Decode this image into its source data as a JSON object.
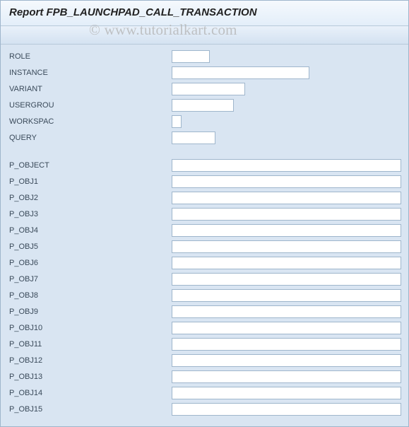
{
  "title": "Report FPB_LAUNCHPAD_CALL_TRANSACTION",
  "watermark": "© www.tutorialkart.com",
  "section1": [
    {
      "label": "ROLE",
      "wclass": "input-role",
      "value": ""
    },
    {
      "label": "INSTANCE",
      "wclass": "input-instance",
      "value": ""
    },
    {
      "label": "VARIANT",
      "wclass": "input-variant",
      "value": ""
    },
    {
      "label": "USERGROU",
      "wclass": "input-usergrou",
      "value": ""
    },
    {
      "label": "WORKSPAC",
      "wclass": "input-workspac",
      "value": ""
    },
    {
      "label": "QUERY",
      "wclass": "input-query",
      "value": ""
    }
  ],
  "section2": [
    {
      "label": "P_OBJECT",
      "value": ""
    },
    {
      "label": "P_OBJ1",
      "value": ""
    },
    {
      "label": "P_OBJ2",
      "value": ""
    },
    {
      "label": "P_OBJ3",
      "value": ""
    },
    {
      "label": "P_OBJ4",
      "value": ""
    },
    {
      "label": "P_OBJ5",
      "value": ""
    },
    {
      "label": "P_OBJ6",
      "value": ""
    },
    {
      "label": "P_OBJ7",
      "value": ""
    },
    {
      "label": "P_OBJ8",
      "value": ""
    },
    {
      "label": "P_OBJ9",
      "value": ""
    },
    {
      "label": "P_OBJ10",
      "value": ""
    },
    {
      "label": "P_OBJ11",
      "value": ""
    },
    {
      "label": "P_OBJ12",
      "value": ""
    },
    {
      "label": "P_OBJ13",
      "value": ""
    },
    {
      "label": "P_OBJ14",
      "value": ""
    },
    {
      "label": "P_OBJ15",
      "value": ""
    }
  ]
}
